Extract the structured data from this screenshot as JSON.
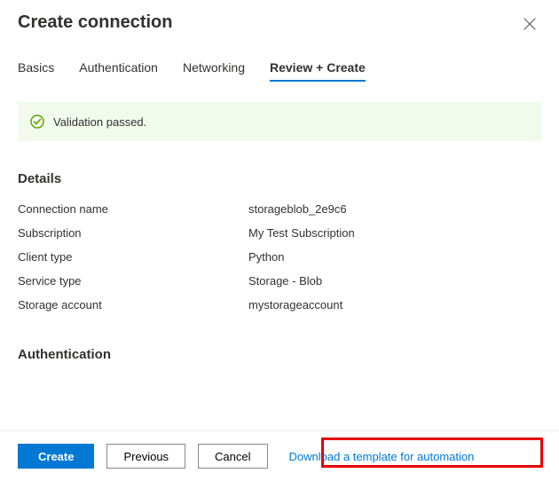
{
  "header": {
    "title": "Create connection"
  },
  "tabs": {
    "items": [
      {
        "label": "Basics",
        "active": false
      },
      {
        "label": "Authentication",
        "active": false
      },
      {
        "label": "Networking",
        "active": false
      },
      {
        "label": "Review + Create",
        "active": true
      }
    ]
  },
  "validation": {
    "message": "Validation passed."
  },
  "sections": {
    "details_heading": "Details",
    "auth_heading": "Authentication"
  },
  "details": [
    {
      "label": "Connection name",
      "value": "storageblob_2e9c6"
    },
    {
      "label": "Subscription",
      "value": "My Test Subscription"
    },
    {
      "label": "Client type",
      "value": "Python"
    },
    {
      "label": "Service type",
      "value": "Storage - Blob"
    },
    {
      "label": "Storage account",
      "value": "mystorageaccount"
    }
  ],
  "footer": {
    "create": "Create",
    "previous": "Previous",
    "cancel": "Cancel",
    "download_link": "Download a template for automation"
  }
}
